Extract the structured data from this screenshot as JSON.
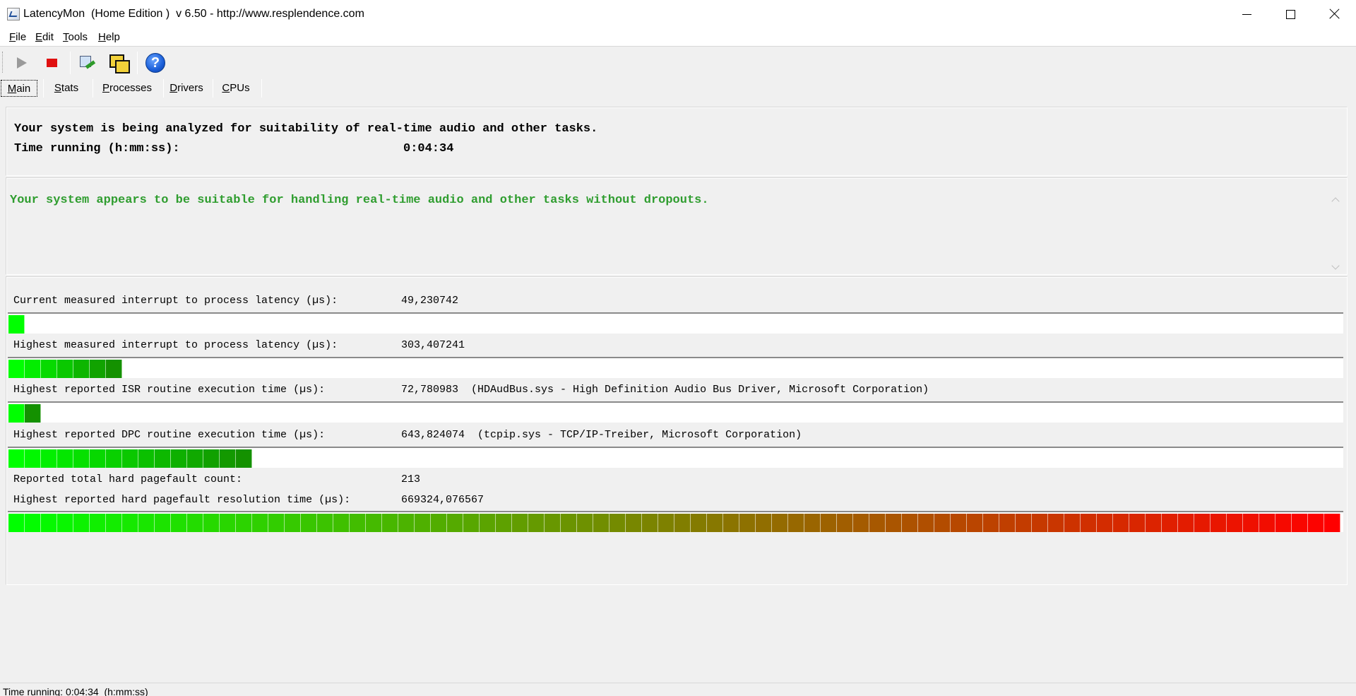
{
  "window": {
    "title": "LatencyMon  (Home Edition )  v 6.50 - http://www.resplendence.com"
  },
  "menu": [
    {
      "key": "F",
      "rest": "ile"
    },
    {
      "key": "E",
      "rest": "dit"
    },
    {
      "key": "T",
      "rest": "ools"
    },
    {
      "key": "H",
      "rest": "elp"
    }
  ],
  "toolbar": {
    "icons": [
      "play-icon",
      "stop-icon",
      "device-manager-icon",
      "windows-icon",
      "help-icon"
    ],
    "help_glyph": "?"
  },
  "tabs": [
    {
      "key": "M",
      "rest": "ain",
      "active": true
    },
    {
      "key": "S",
      "rest": "tats",
      "active": false
    },
    {
      "key": "P",
      "rest": "rocesses",
      "active": false
    },
    {
      "key": "D",
      "rest": "rivers",
      "active": false
    },
    {
      "key": "C",
      "rest": "PUs",
      "active": false
    }
  ],
  "status_panel": {
    "analyzing_text": "Your system is being analyzed for suitability of real-time audio and other tasks.",
    "time_label": "Time running (h:mm:ss):",
    "time_value": "0:04:34"
  },
  "verdict": {
    "text": "Your system appears to be suitable for handling real-time audio and other tasks without dropouts.",
    "color": "#2f9d2f"
  },
  "metrics": {
    "current_interrupt": {
      "label": "Current measured interrupt to process latency (µs):",
      "value": "49,230742",
      "bar_segments": 1
    },
    "highest_interrupt": {
      "label": "Highest measured interrupt to process latency (µs):",
      "value": "303,407241",
      "bar_segments": 7
    },
    "highest_isr": {
      "label": "Highest reported ISR routine execution time (µs):",
      "value": "72,780983",
      "detail": "(HDAudBus.sys - High Definition Audio Bus Driver, Microsoft Corporation)",
      "bar_segments": 2
    },
    "highest_dpc": {
      "label": "Highest reported DPC routine execution time (µs):",
      "value": "643,824074",
      "detail": "(tcpip.sys - TCP/IP-Treiber, Microsoft Corporation)",
      "bar_segments": 15
    },
    "pagefault_count": {
      "label": "Reported total hard pagefault count:",
      "value": "213"
    },
    "pagefault_time": {
      "label": "Highest reported hard pagefault resolution time (µs):",
      "value": "669324,076567",
      "bar_segments": 82
    }
  },
  "bar_scale": {
    "total_segments": 82,
    "start_color": "#00ff00",
    "end_color": "#ff0000"
  },
  "statusbar": {
    "text": "Time running: 0:04:34  (h:mm:ss)"
  }
}
